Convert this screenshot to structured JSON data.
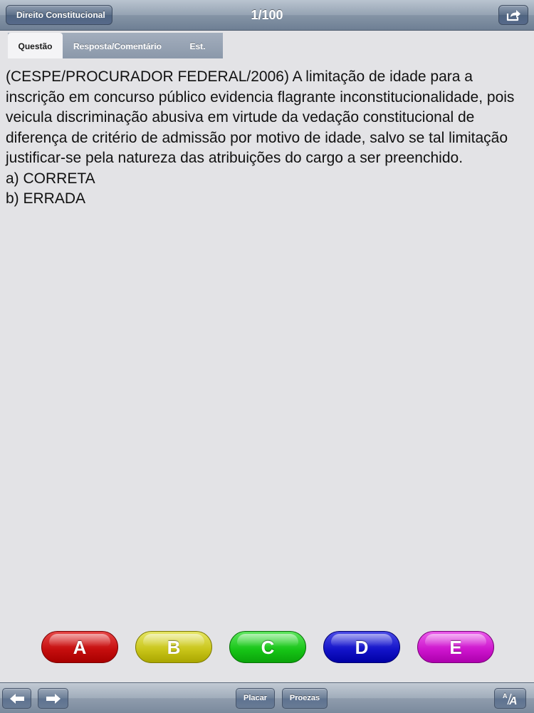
{
  "navbar": {
    "back_label": "Direito Constitucional",
    "title": "1/100",
    "share_icon": "share-icon"
  },
  "tabs": [
    {
      "label": "Questão",
      "active": true
    },
    {
      "label": "Resposta/Comentário",
      "active": false
    },
    {
      "label": "Est.",
      "active": false
    }
  ],
  "question": {
    "text": "(CESPE/PROCURADOR FEDERAL/2006) A limitação de idade para a inscrição em concurso público evidencia flagrante inconstitucionalidade, pois veicula discriminação abusiva em virtude da vedação constitucional de diferença de critério de admissão por motivo de idade, salvo se tal limitação justificar-se pela natureza das atribuições do cargo a ser preenchido.",
    "options": [
      "a) CORRETA",
      "b) ERRADA"
    ]
  },
  "answers": [
    {
      "label": "A",
      "color": "#c40d0d"
    },
    {
      "label": "B",
      "color": "#c8c418"
    },
    {
      "label": "C",
      "color": "#16c416"
    },
    {
      "label": "D",
      "color": "#1212c8"
    },
    {
      "label": "E",
      "color": "#cc14cc"
    }
  ],
  "toolbar": {
    "prev_icon": "arrow-left-icon",
    "next_icon": "arrow-right-icon",
    "placar_label": "Placar",
    "proezas_label": "Proezas",
    "font_icon": "font-size-icon"
  }
}
